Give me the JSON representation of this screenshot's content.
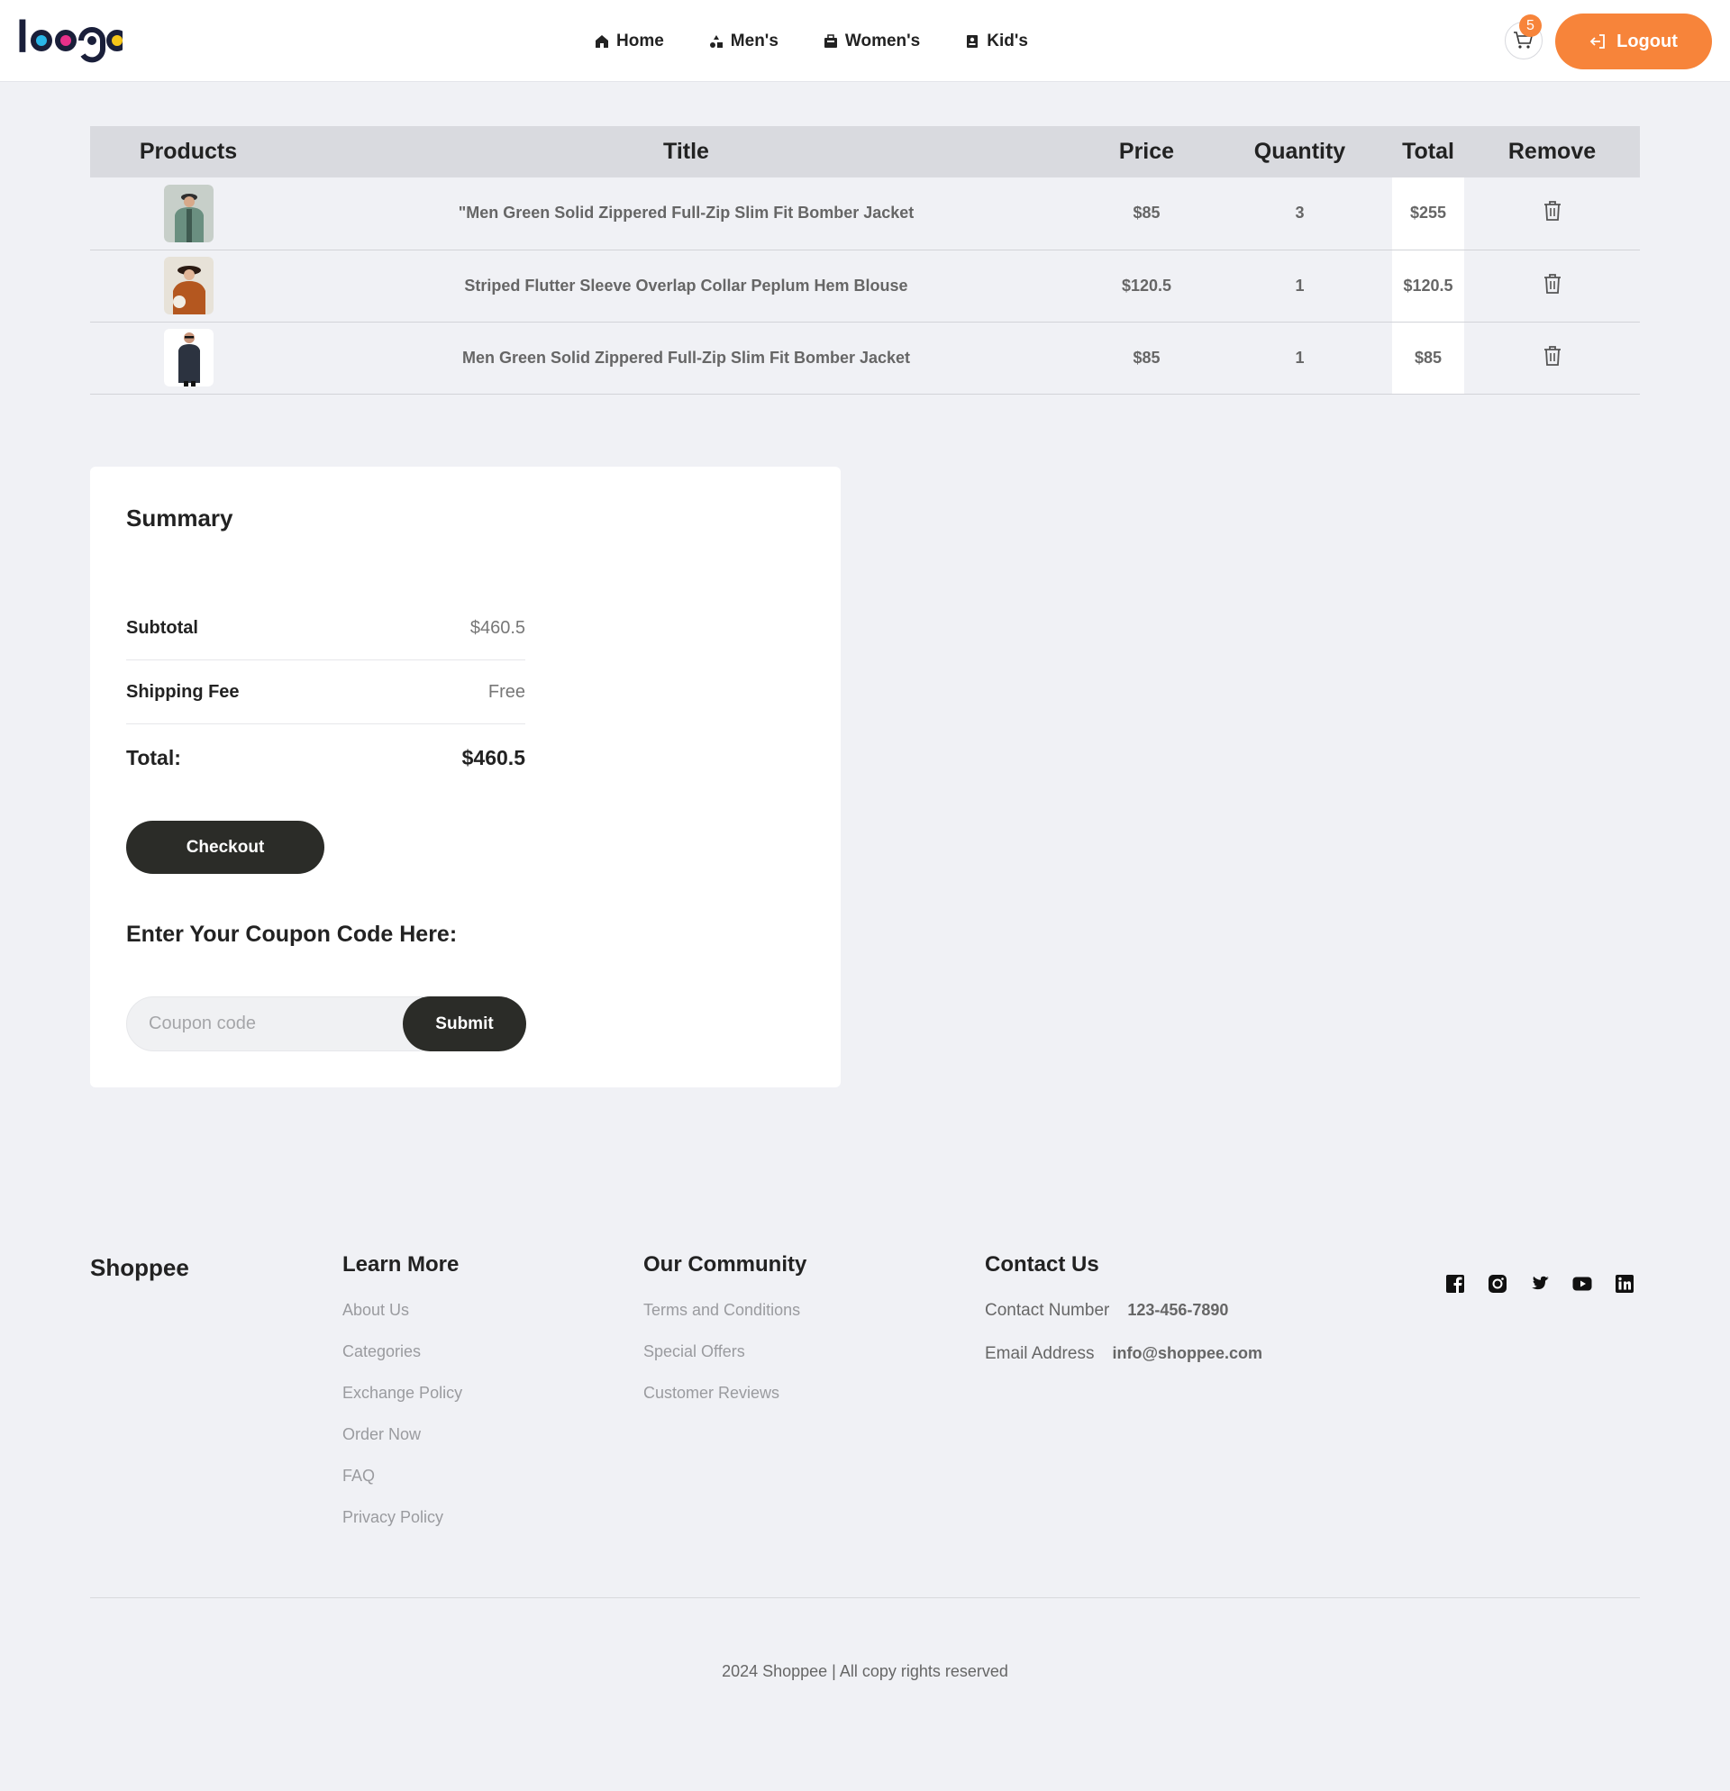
{
  "header": {
    "logo_text": "logo",
    "nav": [
      {
        "label": "Home",
        "icon": "home-icon"
      },
      {
        "label": "Men's",
        "icon": "shapes-icon"
      },
      {
        "label": "Women's",
        "icon": "briefcase-icon"
      },
      {
        "label": "Kid's",
        "icon": "contact-card-icon"
      }
    ],
    "cart_count": "5",
    "logout_label": "Logout"
  },
  "table": {
    "headers": {
      "products": "Products",
      "title": "Title",
      "price": "Price",
      "quantity": "Quantity",
      "total": "Total",
      "remove": "Remove"
    },
    "rows": [
      {
        "title": "\"Men Green Solid Zippered Full-Zip Slim Fit Bomber Jacket",
        "price": "$85",
        "quantity": "3",
        "total": "$255"
      },
      {
        "title": "Striped Flutter Sleeve Overlap Collar Peplum Hem Blouse",
        "price": "$120.5",
        "quantity": "1",
        "total": "$120.5"
      },
      {
        "title": "Men Green Solid Zippered Full-Zip Slim Fit Bomber Jacket",
        "price": "$85",
        "quantity": "1",
        "total": "$85"
      }
    ]
  },
  "summary": {
    "title": "Summary",
    "subtotal_label": "Subtotal",
    "subtotal_value": "$460.5",
    "shipping_label": "Shipping Fee",
    "shipping_value": "Free",
    "total_label": "Total:",
    "total_value": "$460.5",
    "checkout_label": "Checkout",
    "coupon_title": "Enter Your Coupon Code Here:",
    "coupon_placeholder": "Coupon code",
    "submit_label": "Submit"
  },
  "footer": {
    "brand": "Shoppee",
    "learn_more": {
      "title": "Learn More",
      "links": [
        "About Us",
        "Categories",
        "Exchange Policy",
        "Order Now",
        "FAQ",
        "Privacy Policy"
      ]
    },
    "community": {
      "title": "Our Community",
      "links": [
        "Terms and Conditions",
        "Special Offers",
        "Customer Reviews"
      ]
    },
    "contact": {
      "title": "Contact Us",
      "phone_label": "Contact Number",
      "phone_value": "123-456-7890",
      "email_label": "Email Address",
      "email_value": "info@shoppee.com"
    },
    "socials": [
      "facebook-icon",
      "instagram-icon",
      "twitter-icon",
      "youtube-icon",
      "linkedin-icon"
    ],
    "copyright": "2024 Shoppee | All copy rights reserved"
  },
  "colors": {
    "accent": "#f7843a",
    "dark_button": "#2b2c28",
    "background": "#f0f1f5"
  }
}
